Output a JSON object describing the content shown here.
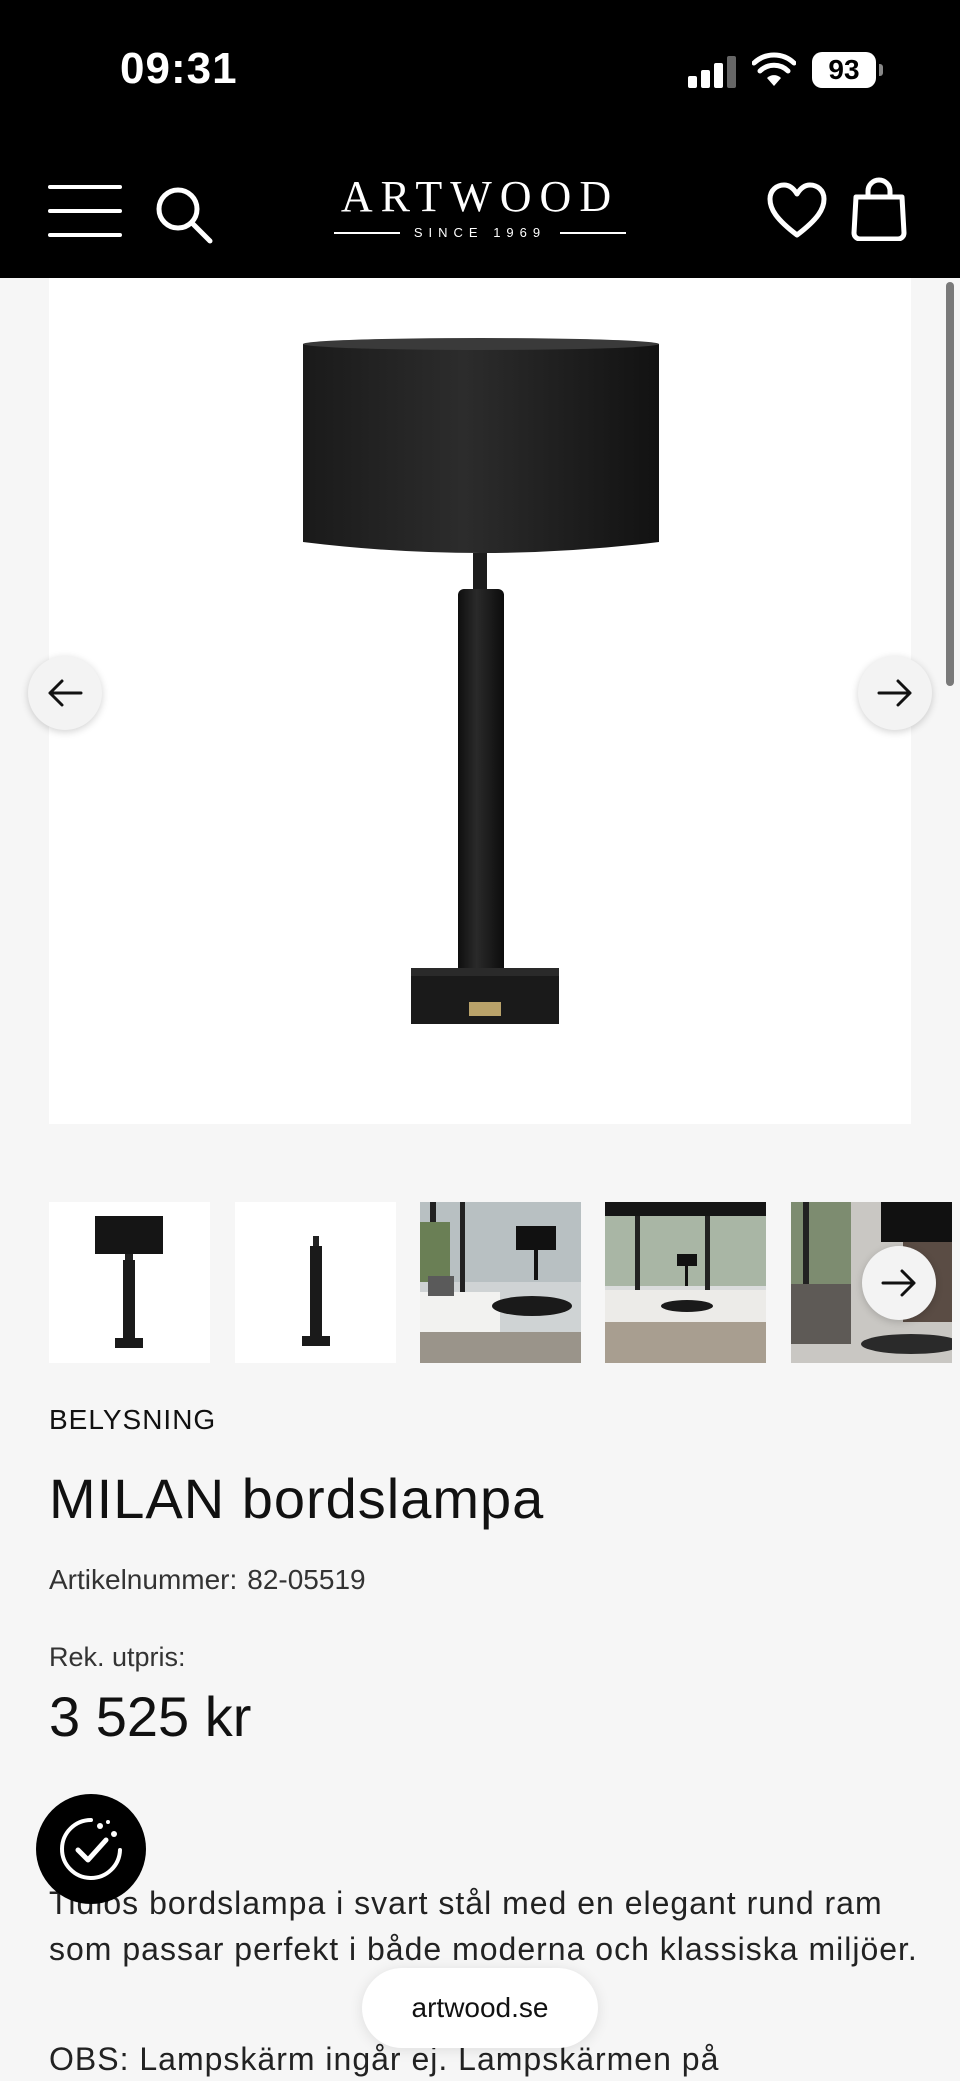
{
  "status_bar": {
    "time": "09:31",
    "battery": "93"
  },
  "header": {
    "logo": "ARTWOOD",
    "logo_tagline": "SINCE 1969"
  },
  "product": {
    "category": "BELYSNING",
    "title": "MILAN bordslampa",
    "sku_label": "Artikelnummer:",
    "sku_value": "82-05519",
    "price_label": "Rek. utpris:",
    "price": "3 525 kr",
    "description": "Tidlös bordslampa i svart stål med en elegant rund ram som passar perfekt i både moderna och klassiska miljöer.",
    "note": "OBS: Lampskärm ingår ej. Lampskärmen på"
  },
  "gallery": {
    "thumbnails": [
      "lamp-with-shade",
      "lamp-base",
      "living-room-1",
      "living-room-2",
      "living-room-3"
    ]
  },
  "browser": {
    "url": "artwood.se"
  },
  "colors": {
    "header_bg": "#000000",
    "page_bg": "#f6f6f6",
    "image_bg": "#ffffff"
  }
}
